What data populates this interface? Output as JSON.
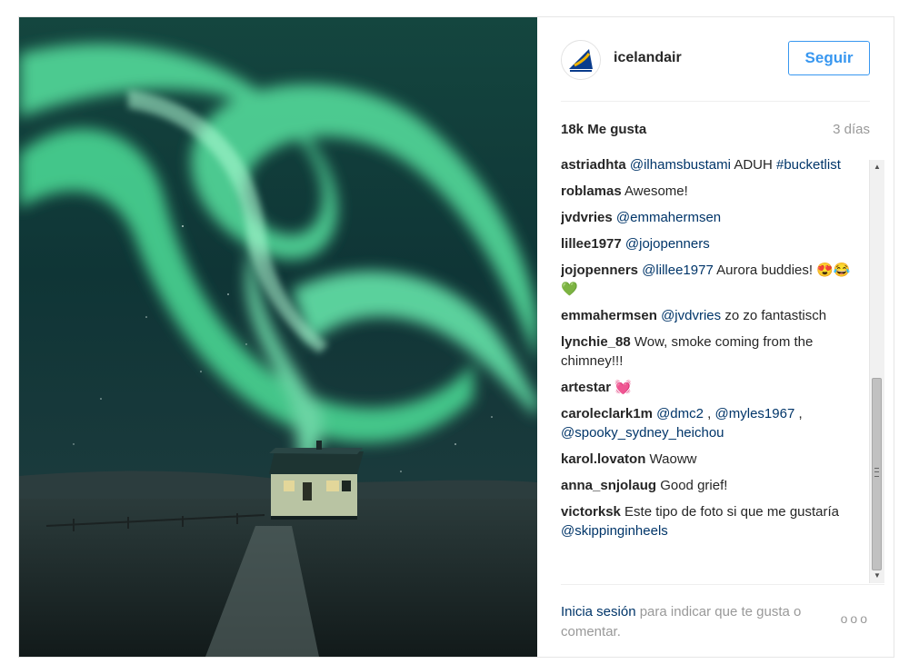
{
  "header": {
    "username": "icelandair",
    "follow_label": "Seguir"
  },
  "meta": {
    "likes": "18k Me gusta",
    "time": "3 días"
  },
  "comments": [
    {
      "user": "astriadhta",
      "text": "ADUH",
      "mention": "@ilhamsbustami",
      "hashtag": "#bucketlist"
    },
    {
      "user": "roblamas",
      "text": "Awesome!"
    },
    {
      "user": "jvdvries",
      "mention": "@emmahermsen"
    },
    {
      "user": "lillee1977",
      "mention": "@jojopenners"
    },
    {
      "user": "jojopenners",
      "mention": "@lillee1977",
      "text": "Aurora buddies!",
      "emoji": "😍😂💚"
    },
    {
      "user": "emmahermsen",
      "mention": "@jvdvries",
      "text": "zo zo fantastisch"
    },
    {
      "user": "lynchie_88",
      "text": "Wow, smoke coming from the chimney!!!"
    },
    {
      "user": "artestar",
      "emoji": "💓"
    },
    {
      "user": "caroleclark1m",
      "mention": "@dmc2",
      "mention2": "@myles1967",
      "mention3": "@spooky_sydney_heichou"
    },
    {
      "user": "karol.lovaton",
      "text": "Waoww"
    },
    {
      "user": "anna_snjolaug",
      "text": "Good grief!"
    },
    {
      "user": "victorksk",
      "text": "Este tipo de foto si que me gustaría",
      "mention": "@skippinginheels"
    }
  ],
  "footer": {
    "login_link": "Inicia sesión",
    "login_rest": "para indicar que te gusta o comentar.",
    "more": "ooo"
  },
  "colors": {
    "accent": "#3897f0",
    "mention": "#003569",
    "muted": "#999999"
  }
}
